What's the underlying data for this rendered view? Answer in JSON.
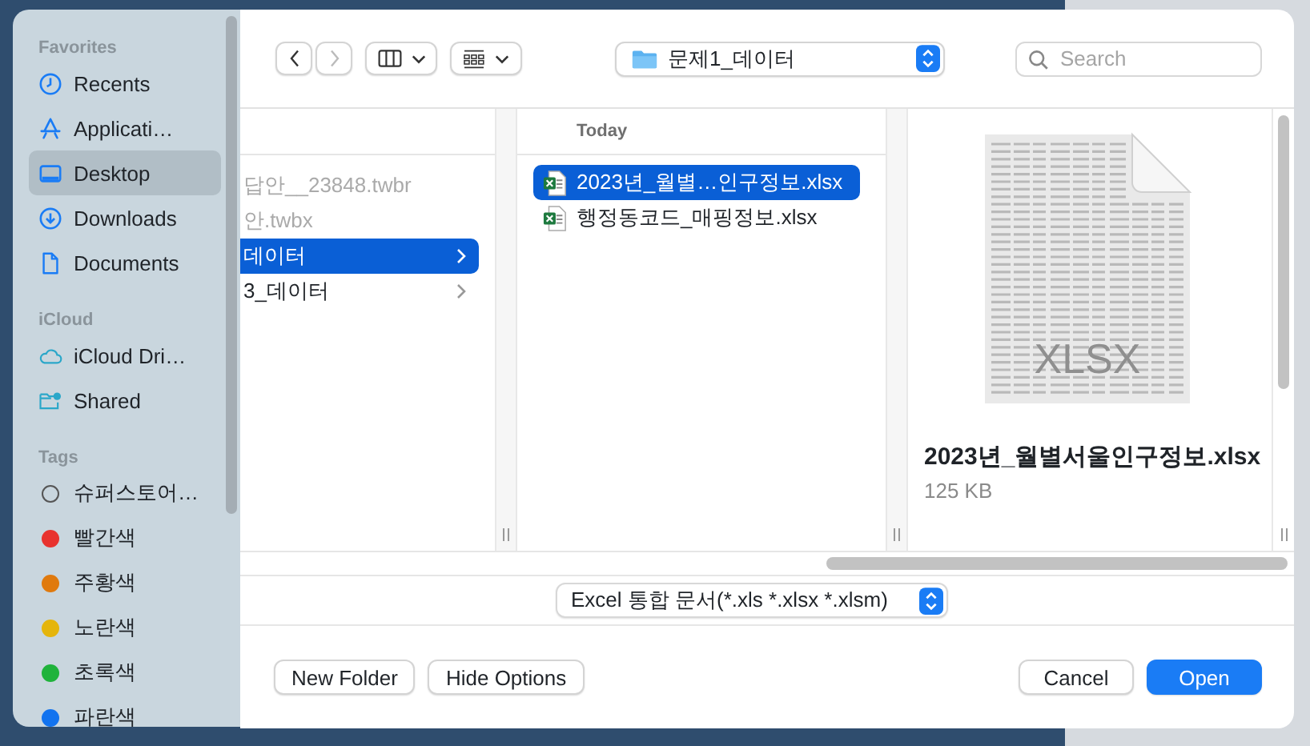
{
  "sidebar": {
    "sections": [
      {
        "heading": "Favorites",
        "items": [
          {
            "label": "Recents",
            "selected": false
          },
          {
            "label": "Applicati…",
            "selected": false
          },
          {
            "label": "Desktop",
            "selected": true
          },
          {
            "label": "Downloads",
            "selected": false
          },
          {
            "label": "Documents",
            "selected": false
          }
        ]
      },
      {
        "heading": "iCloud",
        "items": [
          {
            "label": "iCloud Dri…",
            "selected": false
          },
          {
            "label": "Shared",
            "selected": false
          }
        ]
      },
      {
        "heading": "Tags",
        "tags": [
          {
            "label": "슈퍼스토어…"
          },
          {
            "label": "빨간색",
            "color": "#e8322e"
          },
          {
            "label": "주황색",
            "color": "#e07a0e"
          },
          {
            "label": "노란색",
            "color": "#e5b50c"
          },
          {
            "label": "초록색",
            "color": "#1fb33b"
          },
          {
            "label": "파란색",
            "color": "#1273ef"
          }
        ]
      }
    ]
  },
  "toolbar": {
    "location": "문제1_데이터",
    "search": {
      "placeholder": "Search"
    }
  },
  "columns": [
    {
      "items": [
        {
          "label": "답안__23848.twbr",
          "kind": "file",
          "disabled": true,
          "selected": false
        },
        {
          "label": "안.twbx",
          "kind": "file",
          "disabled": true,
          "selected": false
        },
        {
          "label": "데이터",
          "kind": "folder",
          "disabled": false,
          "selected": true
        },
        {
          "label": "3_데이터",
          "kind": "folder",
          "disabled": false,
          "selected": false
        }
      ]
    },
    {
      "header": "Today",
      "items": [
        {
          "label": "2023년_월별…인구정보.xlsx",
          "kind": "excel",
          "disabled": false,
          "selected": true
        },
        {
          "label": "행정동코드_매핑정보.xlsx",
          "kind": "excel",
          "disabled": false,
          "selected": false
        }
      ]
    }
  ],
  "preview": {
    "icon_text": "XLSX",
    "filename": "2023년_월별서울인구정보.xlsx",
    "size": "125 KB"
  },
  "format": "Excel 통합 문서(*.xls *.xlsx *.xlsm)",
  "buttons": {
    "left": [
      "New Folder",
      "Hide Options"
    ],
    "right": [
      {
        "label": "Cancel",
        "primary": false
      },
      {
        "label": "Open",
        "primary": true
      }
    ]
  }
}
